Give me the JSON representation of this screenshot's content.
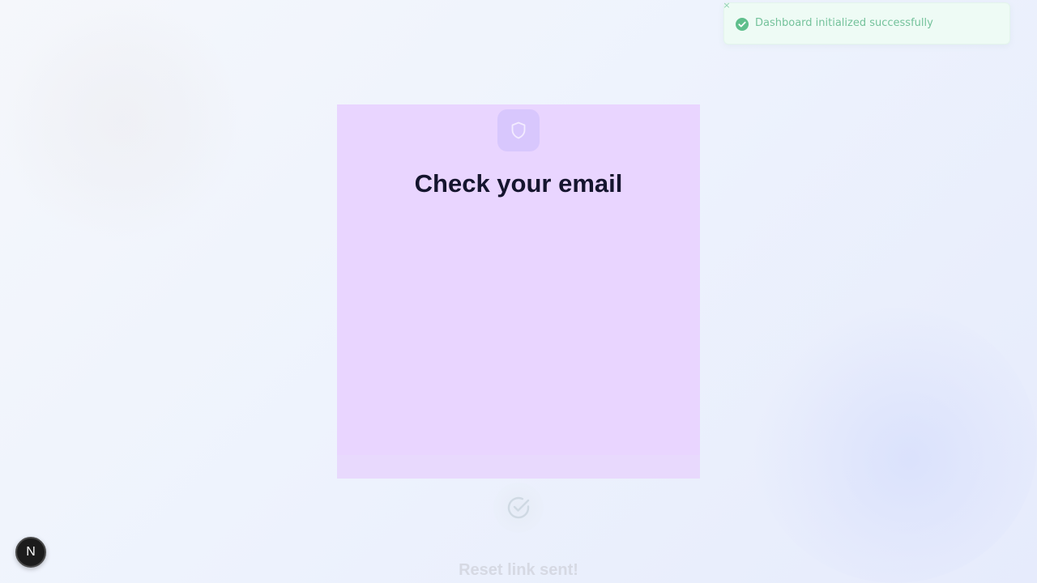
{
  "toast": {
    "message": "Dashboard initialized successfully",
    "close_glyph": "×",
    "status_icon": "check-circle-icon",
    "color": "#74c29b"
  },
  "card": {
    "icon": "shield-icon",
    "title": "Check your email",
    "background": "#e9d5ff"
  },
  "confirmation": {
    "icon": "check-circle-icon",
    "title": "Reset link sent!"
  },
  "dev_indicator": {
    "letter": "N",
    "icon": "nextjs-logo-icon"
  }
}
